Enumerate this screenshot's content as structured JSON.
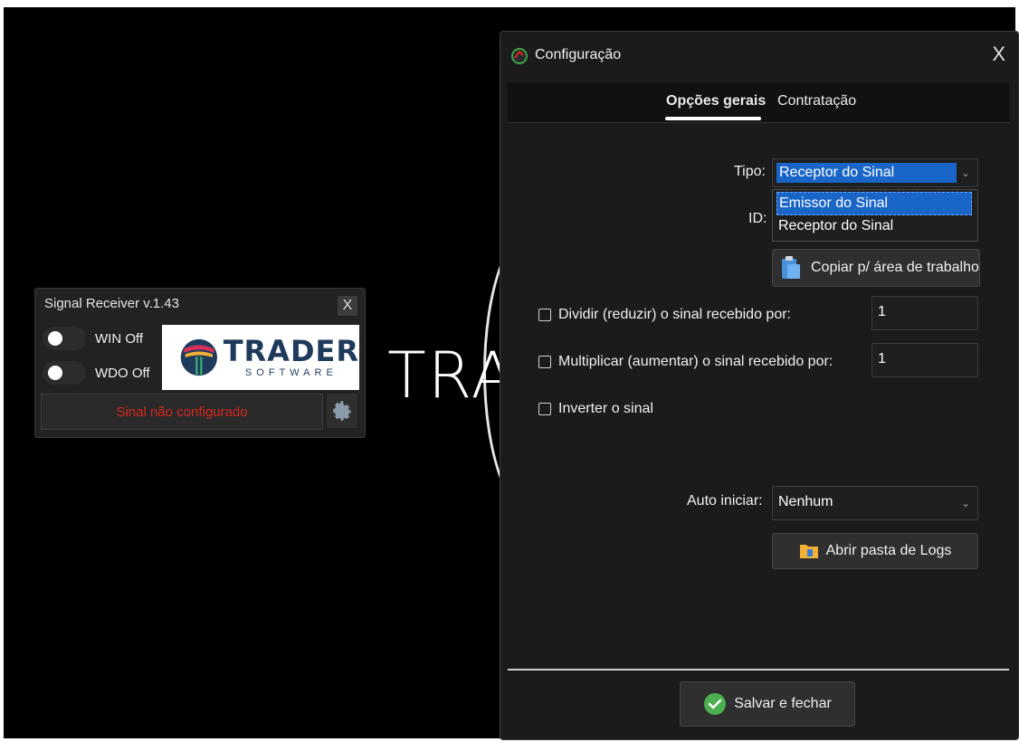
{
  "background": {
    "brand_text": "TRA"
  },
  "widget": {
    "title": "Signal Receiver v.1.43",
    "close_label": "X",
    "toggles": [
      {
        "label": "WIN Off",
        "state": "off"
      },
      {
        "label": "WDO Off",
        "state": "off"
      }
    ],
    "logo": {
      "name": "TRADER",
      "tagline": "SOFTWARE"
    },
    "status_text": "Sinal não configurado",
    "status_color": "#d9261f",
    "settings_icon": "gear-icon"
  },
  "dialog": {
    "title": "Configuração",
    "close_label": "X",
    "tabs": [
      {
        "label": "Opções gerais",
        "active": true
      },
      {
        "label": "Contratação",
        "active": false
      }
    ],
    "tipo": {
      "label": "Tipo:",
      "selected": "Receptor do Sinal",
      "options": [
        "Emissor do Sinal",
        "Receptor do Sinal"
      ],
      "highlighted_option": "Emissor do Sinal"
    },
    "id_label": "ID:",
    "copy_button": "Copiar p/ área de trabalho",
    "dividir": {
      "label": "Dividir (reduzir) o sinal recebido por:",
      "checked": false,
      "value": "1"
    },
    "multiplicar": {
      "label": "Multiplicar (aumentar) o sinal recebido por:",
      "checked": false,
      "value": "1"
    },
    "inverter": {
      "label": "Inverter o sinal",
      "checked": false
    },
    "auto_iniciar": {
      "label": "Auto iniciar:",
      "selected": "Nenhum"
    },
    "logs_button": "Abrir pasta de Logs",
    "save_button": "Salvar e fechar",
    "accent_color": "#1a66c8"
  }
}
